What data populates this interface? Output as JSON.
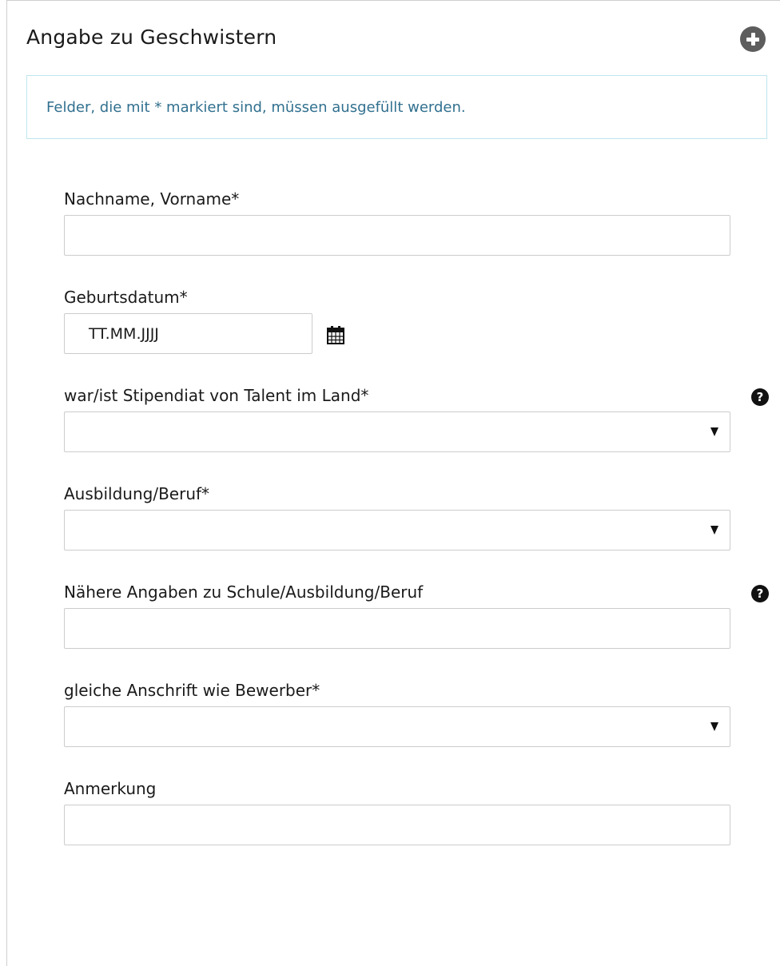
{
  "panel": {
    "title": "Angabe zu Geschwistern",
    "add_icon": "plus-circle-icon"
  },
  "info": {
    "text": "Felder, die mit * markiert sind, müssen ausgefüllt werden."
  },
  "form": {
    "name": {
      "label": "Nachname, Vorname*",
      "value": ""
    },
    "birthdate": {
      "label": "Geburtsdatum*",
      "value": "TT.MM.JJJJ",
      "icon": "calendar-icon"
    },
    "scholar": {
      "label": "war/ist Stipendiat von Talent im Land*",
      "value": "",
      "help_icon": "question-circle-icon",
      "help_glyph": "?"
    },
    "occupation": {
      "label": "Ausbildung/Beruf*",
      "value": ""
    },
    "details": {
      "label": "Nähere Angaben zu Schule/Ausbildung/Beruf",
      "value": "",
      "help_icon": "question-circle-icon",
      "help_glyph": "?"
    },
    "same_address": {
      "label": "gleiche Anschrift wie Bewerber*",
      "value": ""
    },
    "remark": {
      "label": "Anmerkung",
      "value": ""
    }
  }
}
